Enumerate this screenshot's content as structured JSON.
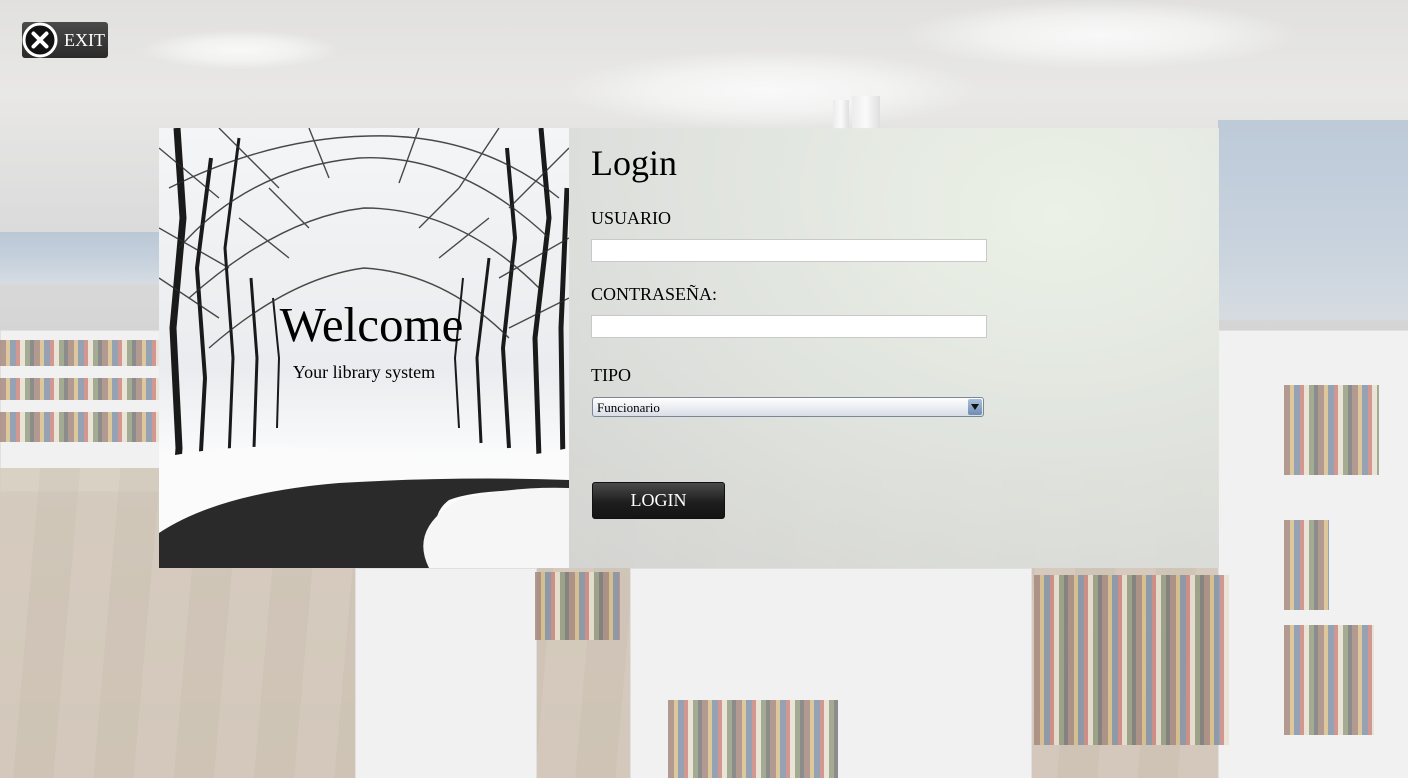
{
  "exit": {
    "label": "EXIT"
  },
  "welcome": {
    "title": "Welcome",
    "subtitle": "Your library system"
  },
  "login": {
    "title": "Login",
    "usuario_label": "USUARIO",
    "usuario_value": "",
    "password_label": "CONTRASEÑA:",
    "password_value": "",
    "tipo_label": "TIPO",
    "tipo_selected": "Funcionario",
    "button_label": "LOGIN"
  },
  "colors": {
    "button_dark": "#1e1e1e",
    "panel_bg": "#e4e8e0"
  },
  "icons": {
    "exit": "close-circle-icon",
    "dropdown": "chevron-down-icon"
  }
}
